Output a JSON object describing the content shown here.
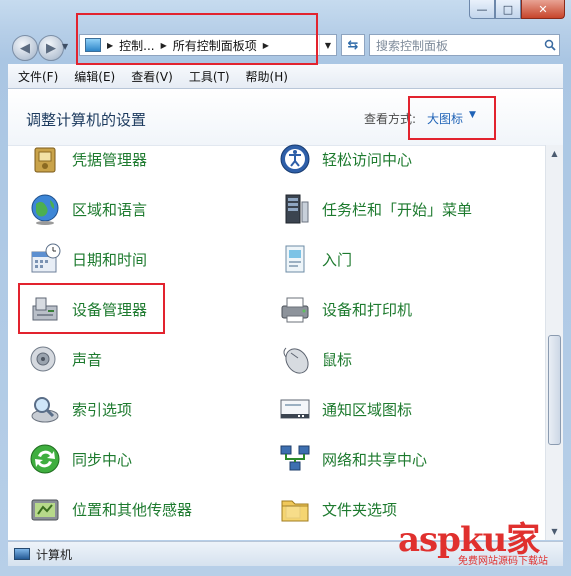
{
  "window": {
    "min": "—",
    "max": "□",
    "close": "✕"
  },
  "address": {
    "crumbs": [
      "控制...",
      "所有控制面板项"
    ]
  },
  "search": {
    "placeholder": "搜索控制面板"
  },
  "menu": [
    "文件(F)",
    "编辑(E)",
    "查看(V)",
    "工具(T)",
    "帮助(H)"
  ],
  "header": {
    "title": "调整计算机的设置",
    "view_label": "查看方式:",
    "view_value": "大图标"
  },
  "items_left": [
    {
      "label": "凭据管理器",
      "icon": "credential-manager-icon"
    },
    {
      "label": "区域和语言",
      "icon": "globe-icon"
    },
    {
      "label": "日期和时间",
      "icon": "calendar-clock-icon"
    },
    {
      "label": "设备管理器",
      "icon": "device-manager-icon"
    },
    {
      "label": "声音",
      "icon": "speaker-icon"
    },
    {
      "label": "索引选项",
      "icon": "index-magnifier-icon"
    },
    {
      "label": "同步中心",
      "icon": "sync-icon"
    },
    {
      "label": "位置和其他传感器",
      "icon": "sensor-icon"
    }
  ],
  "items_right": [
    {
      "label": "轻松访问中心",
      "icon": "accessibility-icon"
    },
    {
      "label": "任务栏和「开始」菜单",
      "icon": "taskbar-icon"
    },
    {
      "label": "入门",
      "icon": "getting-started-icon"
    },
    {
      "label": "设备和打印机",
      "icon": "printer-icon"
    },
    {
      "label": "鼠标",
      "icon": "mouse-icon"
    },
    {
      "label": "通知区域图标",
      "icon": "notification-area-icon"
    },
    {
      "label": "网络和共享中心",
      "icon": "network-icon"
    },
    {
      "label": "文件夹选项",
      "icon": "folder-icon"
    }
  ],
  "statusbar": {
    "text": "计算机"
  },
  "watermark": {
    "brand": "aspku",
    "suffix": "家",
    "caption": "免费网站源码下载站"
  }
}
